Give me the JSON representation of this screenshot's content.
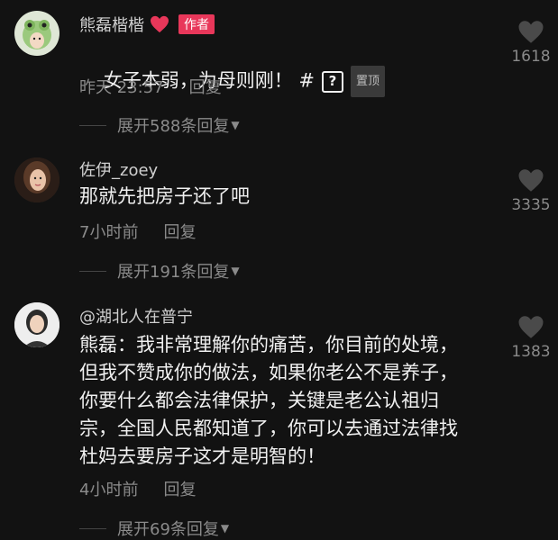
{
  "comments": [
    {
      "username": "熊磊楷楷",
      "author_badge": "作者",
      "text": "女子本弱，为母则刚！ #",
      "pin_label": "置顶",
      "time": "昨天 23:57",
      "reply": "回复",
      "expand": "展开588条回复",
      "likes": "1618"
    },
    {
      "username": "佐伊_zoey",
      "text": "那就先把房子还了吧",
      "time": "7小时前",
      "reply": "回复",
      "expand": "展开191条回复",
      "likes": "3335"
    },
    {
      "username": "@湖北人在普宁",
      "text": "熊磊：我非常理解你的痛苦，你目前的处境，\n但我不赞成你的做法，如果你老公不是养子，\n你要什么都会法律保护，关键是老公认祖归\n宗，全国人民都知道了，你可以去通过法律找\n杜妈去要房子这才是明智的！",
      "time": "4小时前",
      "reply": "回复",
      "expand": "展开69条回复",
      "likes": "1383"
    }
  ],
  "colors": {
    "background": "#121212",
    "author_badge": "#e8375a",
    "heart": "#e8375a",
    "muted": "#8a8a8a"
  }
}
